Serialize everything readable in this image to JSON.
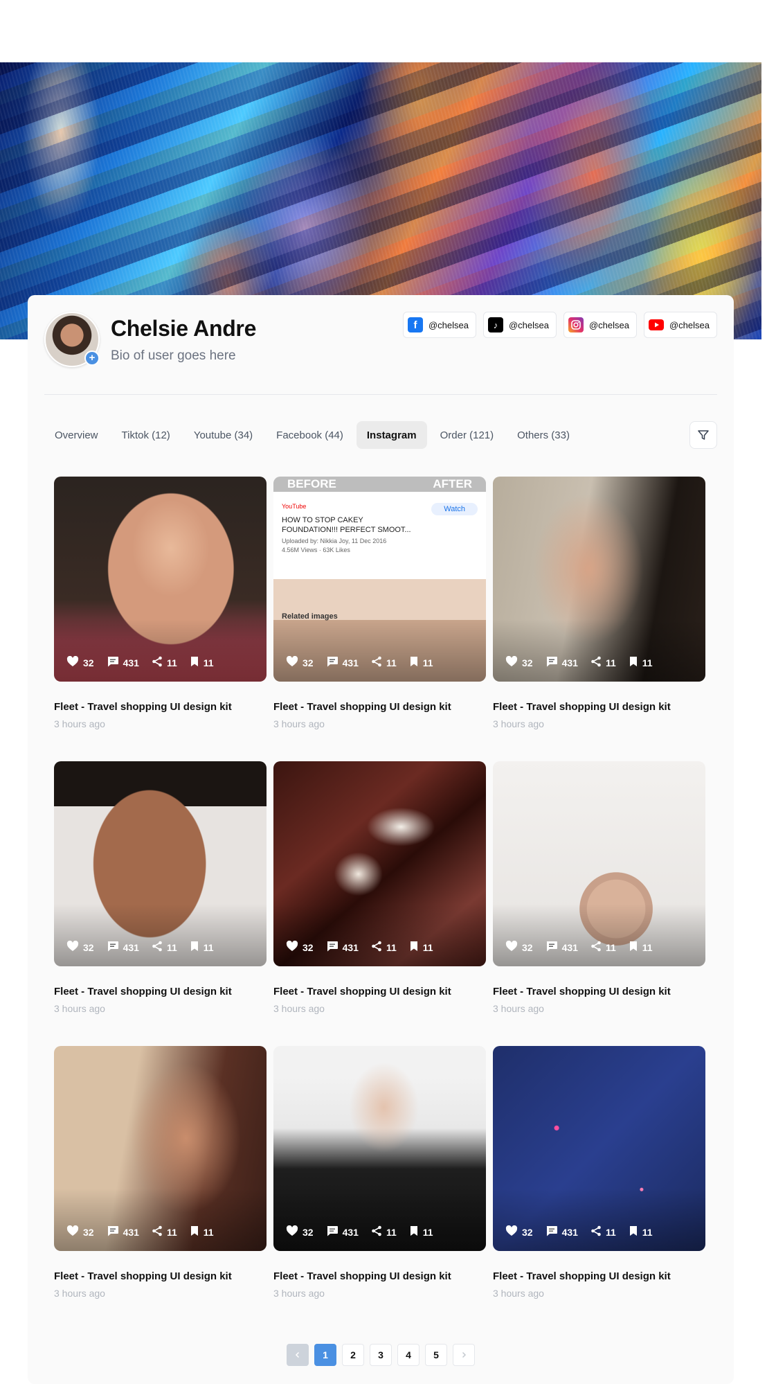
{
  "profile": {
    "name": "Chelsie Andre",
    "bio": "Bio of user goes here"
  },
  "socials": [
    {
      "platform": "facebook",
      "icon": "facebook-icon",
      "handle": "@chelsea"
    },
    {
      "platform": "tiktok",
      "icon": "tiktok-icon",
      "handle": "@chelsea"
    },
    {
      "platform": "instagram",
      "icon": "instagram-icon",
      "handle": "@chelsea"
    },
    {
      "platform": "youtube",
      "icon": "youtube-icon",
      "handle": "@chelsea"
    }
  ],
  "tabs": [
    {
      "label": "Overview"
    },
    {
      "label": "Tiktok (12)"
    },
    {
      "label": "Youtube (34)"
    },
    {
      "label": "Facebook (44)"
    },
    {
      "label": "Instagram",
      "active": true
    },
    {
      "label": "Order (121)"
    },
    {
      "label": "Others (33)"
    }
  ],
  "posts": [
    {
      "title": "Fleet - Travel shopping UI design kit",
      "time": "3 hours ago",
      "likes": "32",
      "comments": "431",
      "shares": "11",
      "saves": "11"
    },
    {
      "title": "Fleet - Travel shopping UI design kit",
      "time": "3 hours ago",
      "likes": "32",
      "comments": "431",
      "shares": "11",
      "saves": "11"
    },
    {
      "title": "Fleet - Travel shopping UI design kit",
      "time": "3 hours ago",
      "likes": "32",
      "comments": "431",
      "shares": "11",
      "saves": "11"
    },
    {
      "title": "Fleet - Travel shopping UI design kit",
      "time": "3 hours ago",
      "likes": "32",
      "comments": "431",
      "shares": "11",
      "saves": "11"
    },
    {
      "title": "Fleet - Travel shopping UI design kit",
      "time": "3 hours ago",
      "likes": "32",
      "comments": "431",
      "shares": "11",
      "saves": "11"
    },
    {
      "title": "Fleet - Travel shopping UI design kit",
      "time": "3 hours ago",
      "likes": "32",
      "comments": "431",
      "shares": "11",
      "saves": "11"
    },
    {
      "title": "Fleet - Travel shopping UI design kit",
      "time": "3 hours ago",
      "likes": "32",
      "comments": "431",
      "shares": "11",
      "saves": "11"
    },
    {
      "title": "Fleet - Travel shopping UI design kit",
      "time": "3 hours ago",
      "likes": "32",
      "comments": "431",
      "shares": "11",
      "saves": "11"
    },
    {
      "title": "Fleet - Travel shopping UI design kit",
      "time": "3 hours ago",
      "likes": "32",
      "comments": "431",
      "shares": "11",
      "saves": "11"
    }
  ],
  "thumb_2_text": {
    "before": "BEFORE",
    "after": "AFTER",
    "source": "YouTube",
    "watch": "Watch",
    "video_title": "HOW TO STOP CAKEY FOUNDATION!!! PERFECT SMOOT...",
    "uploaded": "Uploaded by: Nikkia Joy, 11 Dec 2016",
    "views": "4.56M Views · 63K Likes",
    "related": "Related images"
  },
  "pagination": {
    "pages": [
      "1",
      "2",
      "3",
      "4",
      "5"
    ],
    "current": "1"
  },
  "colors": {
    "accent": "#4a90e2",
    "card_bg": "#fafafa",
    "facebook": "#1877f2",
    "youtube": "#ff0000"
  }
}
